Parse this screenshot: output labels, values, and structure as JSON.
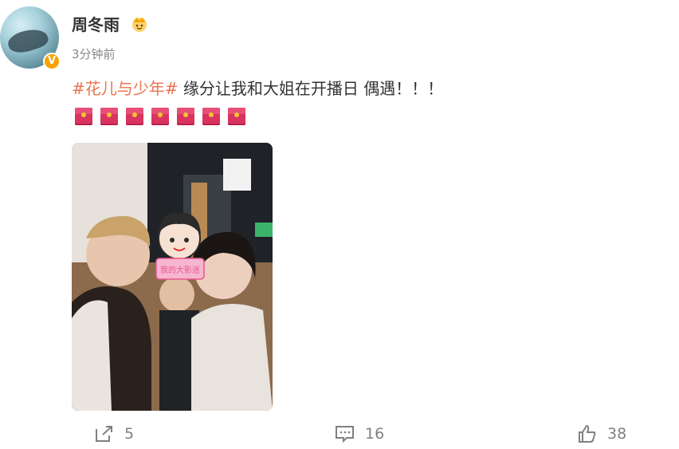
{
  "post": {
    "username": "周冬雨",
    "verified_badge": "V",
    "time": "3分钟前",
    "hashtag": "#花儿与少年#",
    "text": " 缘分让我和大姐在开播日 偶遇！！！",
    "emoji_count": 7,
    "emoji_name": "red-envelope",
    "photo_sticker_text": "我的大影迷"
  },
  "actions": {
    "share_count": "5",
    "comment_count": "16",
    "like_count": "38"
  },
  "colors": {
    "hashtag": "#eb7350",
    "meta_text": "#888888",
    "action_text": "#808080",
    "verified_badge": "#f7a200"
  }
}
